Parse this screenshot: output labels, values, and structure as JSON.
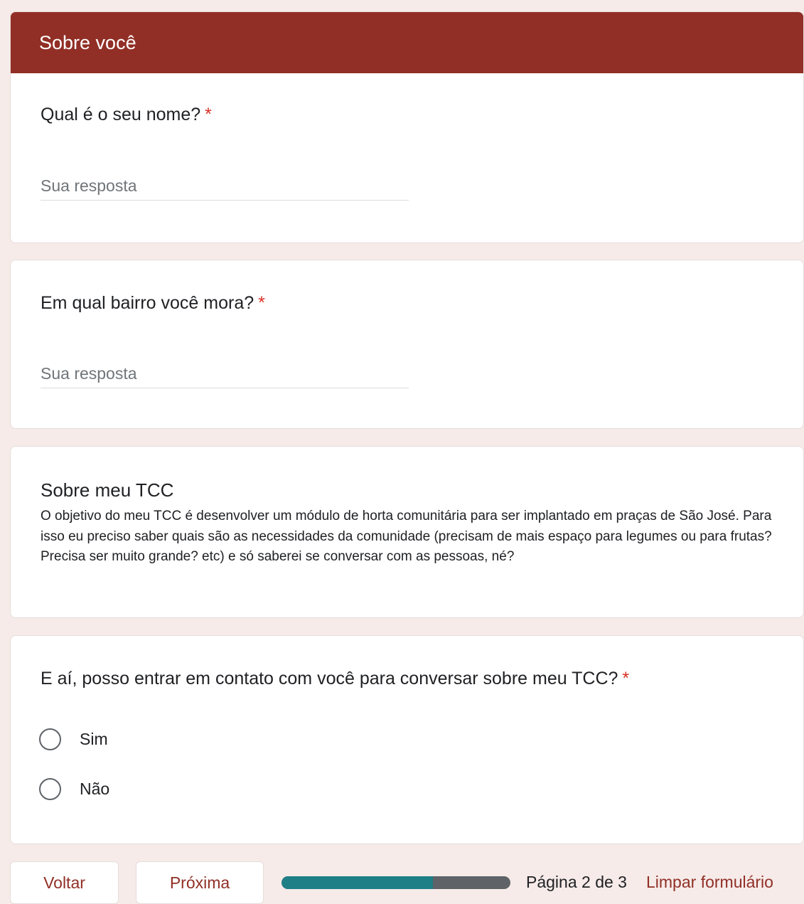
{
  "theme": {
    "header_color": "#912f26",
    "background_color": "#f6ebe9",
    "progress_fill_color": "#1e7f86",
    "progress_track_color": "#5f6368",
    "required_color": "#d93025"
  },
  "section": {
    "title": "Sobre você"
  },
  "questions": [
    {
      "title": "Qual é o seu nome?",
      "required_mark": "*",
      "placeholder": "Sua resposta"
    },
    {
      "title": "Em qual bairro você mora?",
      "required_mark": "*",
      "placeholder": "Sua resposta"
    }
  ],
  "info": {
    "title": "Sobre meu TCC",
    "description": "O objetivo do meu TCC é desenvolver um módulo de horta comunitária para ser implantado em praças de São José. Para isso eu preciso saber quais são as necessidades da comunidade (precisam de mais espaço para legumes ou para frutas? Precisa ser muito grande? etc) e só saberei se conversar com as pessoas, né?"
  },
  "contact_question": {
    "title": "E aí, posso entrar em contato com você para conversar sobre meu TCC?",
    "required_mark": "*",
    "options": [
      "Sim",
      "Não"
    ]
  },
  "footer": {
    "back_label": "Voltar",
    "next_label": "Próxima",
    "progress_fraction": 0.66,
    "page_indicator": "Página 2 de 3",
    "clear_label": "Limpar formulário"
  }
}
